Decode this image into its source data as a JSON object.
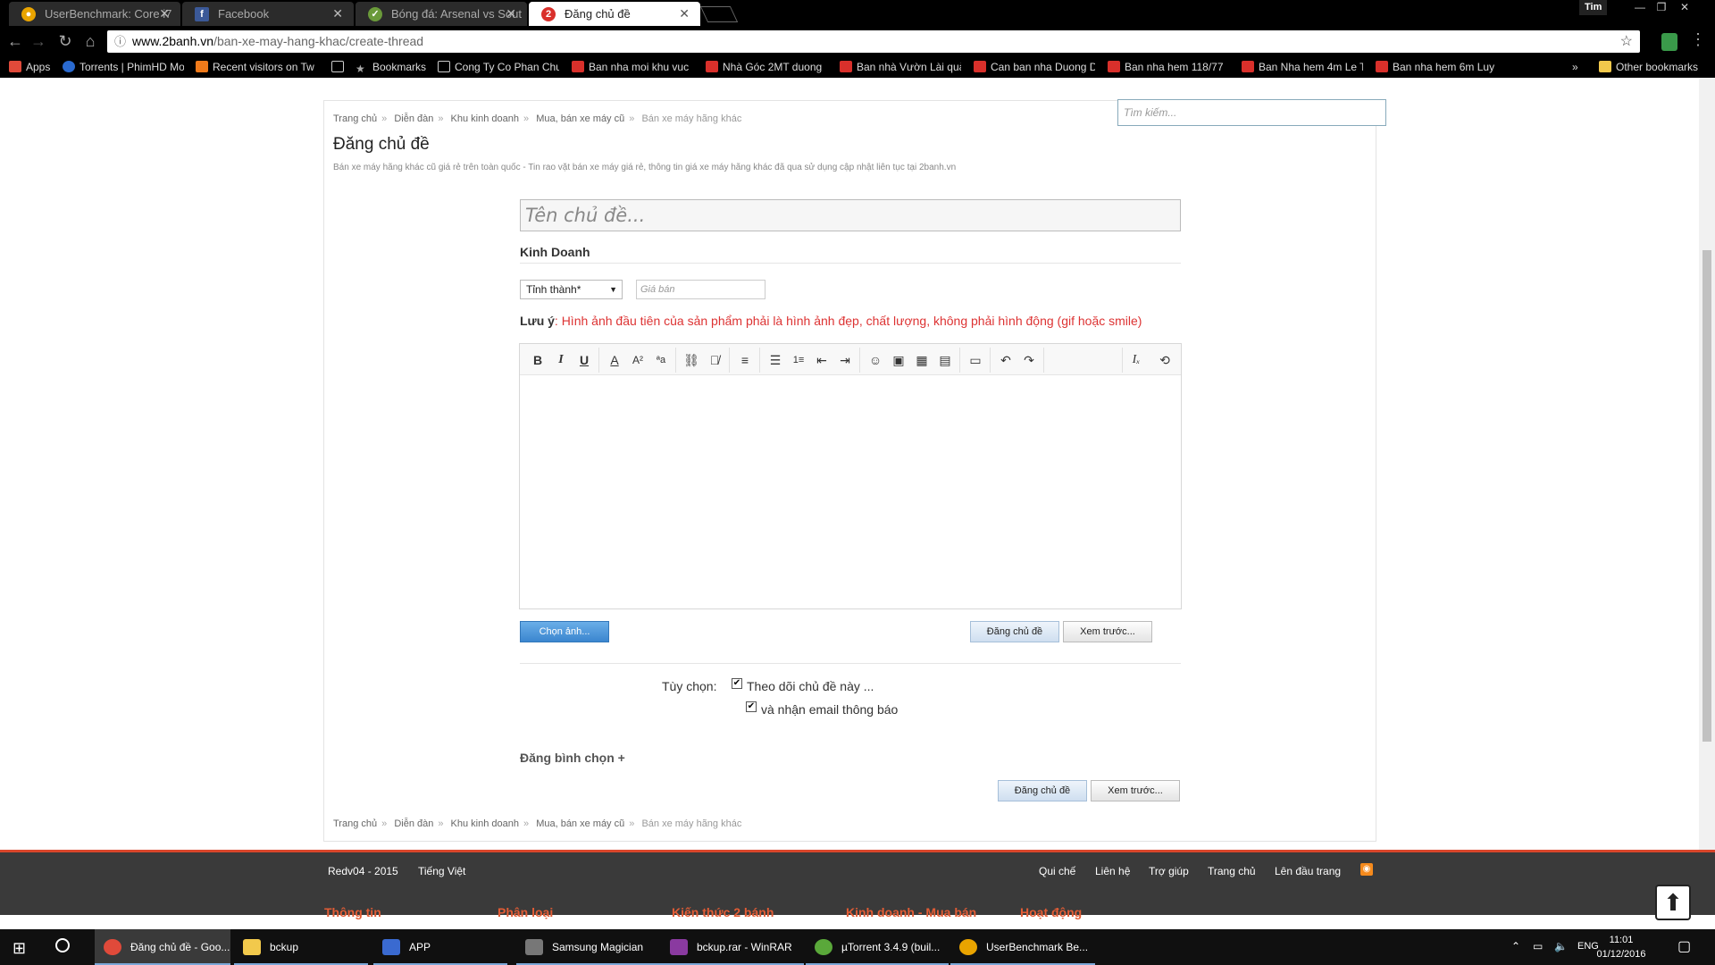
{
  "browser": {
    "tabs": [
      {
        "label": "UserBenchmark: Core i7",
        "icon": "userbenchmark-icon",
        "active": false
      },
      {
        "label": "Facebook",
        "icon": "facebook-icon",
        "active": false
      },
      {
        "label": "Bóng đá: Arsenal vs Sout",
        "icon": "soccer-icon",
        "active": false
      },
      {
        "label": "Đăng chủ đề",
        "icon": "2banh-icon",
        "active": true
      }
    ],
    "user": "Tim",
    "url_host": "www.2banh.vn",
    "url_path": "/ban-xe-may-hang-khac/create-thread",
    "bookmarks": [
      {
        "label": "Apps",
        "icon": "apps-icon"
      },
      {
        "label": "Torrents | PhimHD Mo",
        "icon": "torrent-icon"
      },
      {
        "label": "Recent visitors on Tw",
        "icon": "visitors-icon"
      },
      {
        "label": "",
        "icon": "page-icon"
      },
      {
        "label": "Bookmarks",
        "icon": "star-icon"
      },
      {
        "label": "Cong Ty Co Phan Chu",
        "icon": "page-icon"
      },
      {
        "label": "Ban nha moi khu vuc",
        "icon": "house-icon"
      },
      {
        "label": "Nhà Góc 2MT duong",
        "icon": "house-icon"
      },
      {
        "label": "Ban nhà Vườn Lài quả",
        "icon": "house-icon"
      },
      {
        "label": "Can ban nha Duong D",
        "icon": "house-icon"
      },
      {
        "label": "Ban nha hem 118/77",
        "icon": "house-icon"
      },
      {
        "label": "Ban Nha hem 4m Le T",
        "icon": "house-icon"
      },
      {
        "label": "Ban nha hem 6m Luy",
        "icon": "house-icon"
      }
    ],
    "overflow": "»",
    "other_bookmarks": "Other bookmarks"
  },
  "page": {
    "breadcrumb": [
      "Trang chủ",
      "Diễn đàn",
      "Khu kinh doanh",
      "Mua, bán xe máy cũ",
      "Bán xe máy hãng khác"
    ],
    "breadcrumb_sep": "»",
    "search_placeholder": "Tìm kiếm...",
    "title": "Đăng chủ đề",
    "description": "Bán xe máy hãng khác cũ giá rẻ trên toàn quốc - Tin rao vặt bán xe máy giá rẻ, thông tin giá xe máy hãng khác đã qua sử dụng cập nhật liên tục tại 2banh.vn",
    "thread_title_placeholder": "Tên chủ đề...",
    "section_label": "Kinh Doanh",
    "province_select": "Tỉnh thành*",
    "price_placeholder": "Giá bán",
    "note_label": "Lưu ý",
    "note_text": ": Hình ảnh đầu tiên của sản phẩm phải là hình ảnh đẹp, chất lượng, không phải hình động (gif hoặc smile)",
    "toolbar": [
      "bold-icon",
      "italic-icon",
      "underline-icon",
      "text-color-icon",
      "font-size-icon",
      "font-style-icon",
      "link-icon",
      "unlink-icon",
      "align-icon",
      "bullet-list-icon",
      "number-list-icon",
      "outdent-icon",
      "indent-icon",
      "smiley-icon",
      "image-icon",
      "media-icon",
      "quote-icon",
      "save-icon",
      "undo-icon",
      "redo-icon",
      "remove-format-icon",
      "source-icon"
    ],
    "choose_image": "Chọn ảnh...",
    "post_button": "Đăng chủ đề",
    "preview_button": "Xem trước...",
    "options_label": "Tùy chọn:",
    "option_watch": "Theo dõi chủ đề này ...",
    "option_email": "và nhận email thông báo",
    "poll_link": "Đăng bình chọn +"
  },
  "footer": {
    "left": [
      "Redv04 - 2015",
      "Tiếng Việt"
    ],
    "links": [
      "Qui chế",
      "Liên hệ",
      "Trợ giúp",
      "Trang chủ",
      "Lên đầu trang"
    ],
    "headings": [
      "Thông tin",
      "Phân loại",
      "Kiến thức 2 bánh",
      "Kinh doanh - Mua bán",
      "Hoạt động"
    ]
  },
  "taskbar": {
    "items": [
      "Đăng chủ đề - Goo...",
      "bckup",
      "APP",
      "Samsung Magician",
      "bckup.rar - WinRAR",
      "µTorrent 3.4.9  (buil...",
      "UserBenchmark Be..."
    ],
    "lang": "ENG",
    "time": "11:01",
    "date": "01/12/2016"
  },
  "colors": {
    "accent_red": "#d9462b",
    "footer_heading": "#e25c35",
    "note_red": "#dd3333",
    "primary_blue": "#3b86cf"
  }
}
